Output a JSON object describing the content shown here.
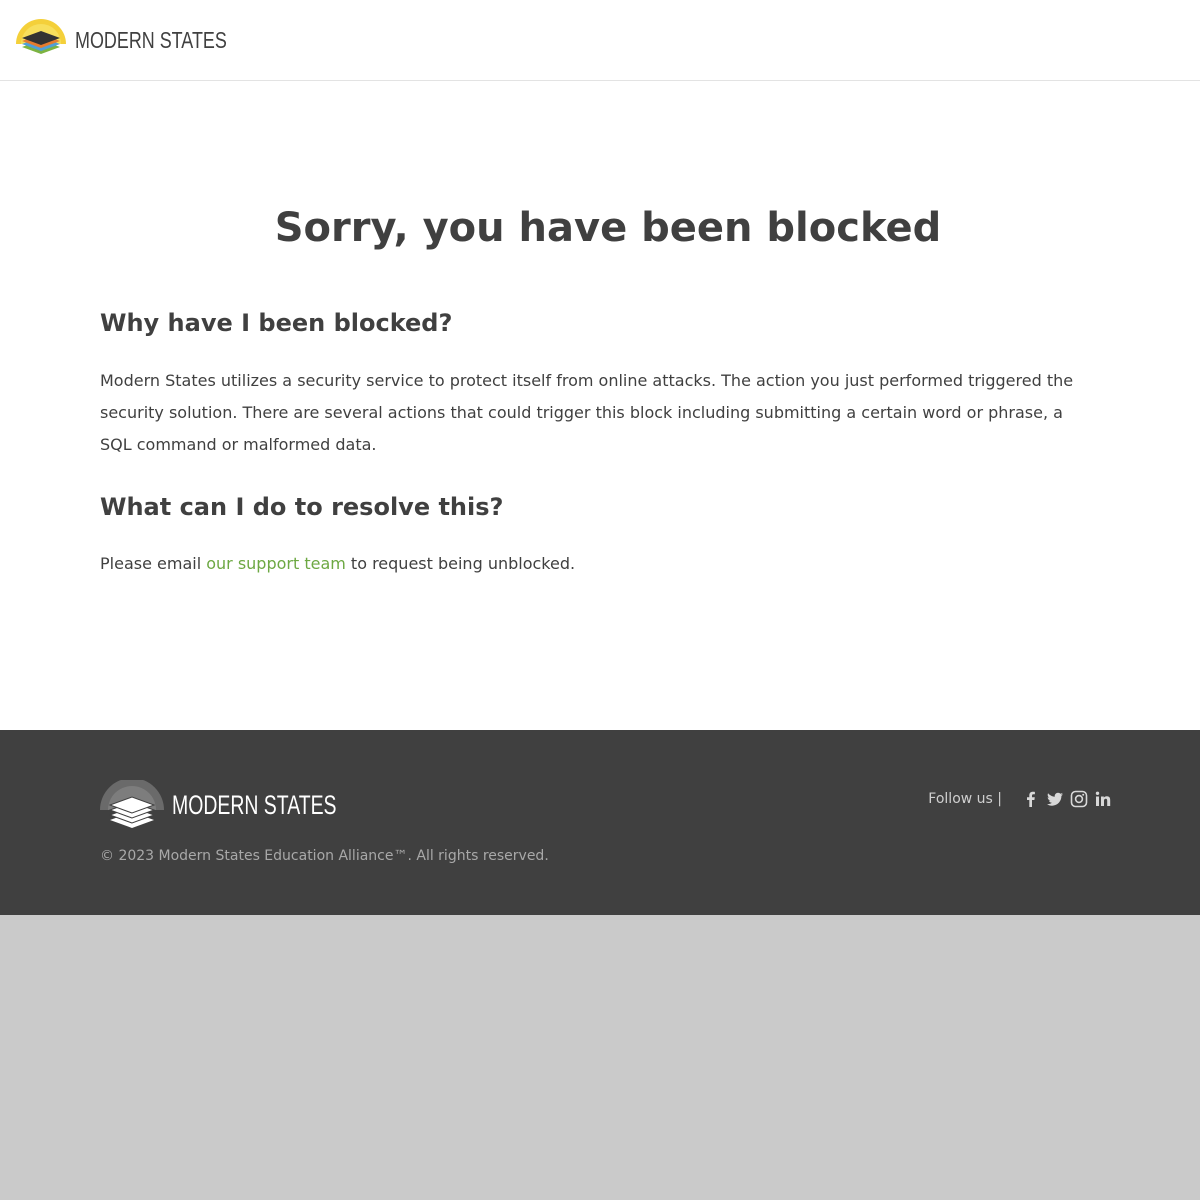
{
  "header": {
    "brand": "MODERN STATES",
    "logo_icon": "modern-states-logo-icon"
  },
  "main": {
    "title": "Sorry, you have been blocked",
    "why_heading": "Why have I been blocked?",
    "why_text": "Modern States utilizes a security service to protect itself from online attacks. The action you just performed triggered the security solution. There are several actions that could trigger this block including submitting a certain word or phrase, a SQL command or malformed data.",
    "resolve_heading": "What can I do to resolve this?",
    "resolve_prefix": "Please email ",
    "resolve_link": "our support team",
    "resolve_suffix": " to request being unblocked."
  },
  "footer": {
    "brand": "MODERN STATES",
    "copyright": "© 2023 Modern States Education Alliance™. All rights reserved.",
    "follow_label": "Follow us |",
    "social": [
      {
        "icon": "facebook-icon"
      },
      {
        "icon": "twitter-icon"
      },
      {
        "icon": "instagram-icon"
      },
      {
        "icon": "linkedin-icon"
      }
    ]
  },
  "colors": {
    "link_green": "#6da843",
    "footer_bg": "#404040",
    "page_bg": "#cacaca",
    "text": "#404040"
  }
}
